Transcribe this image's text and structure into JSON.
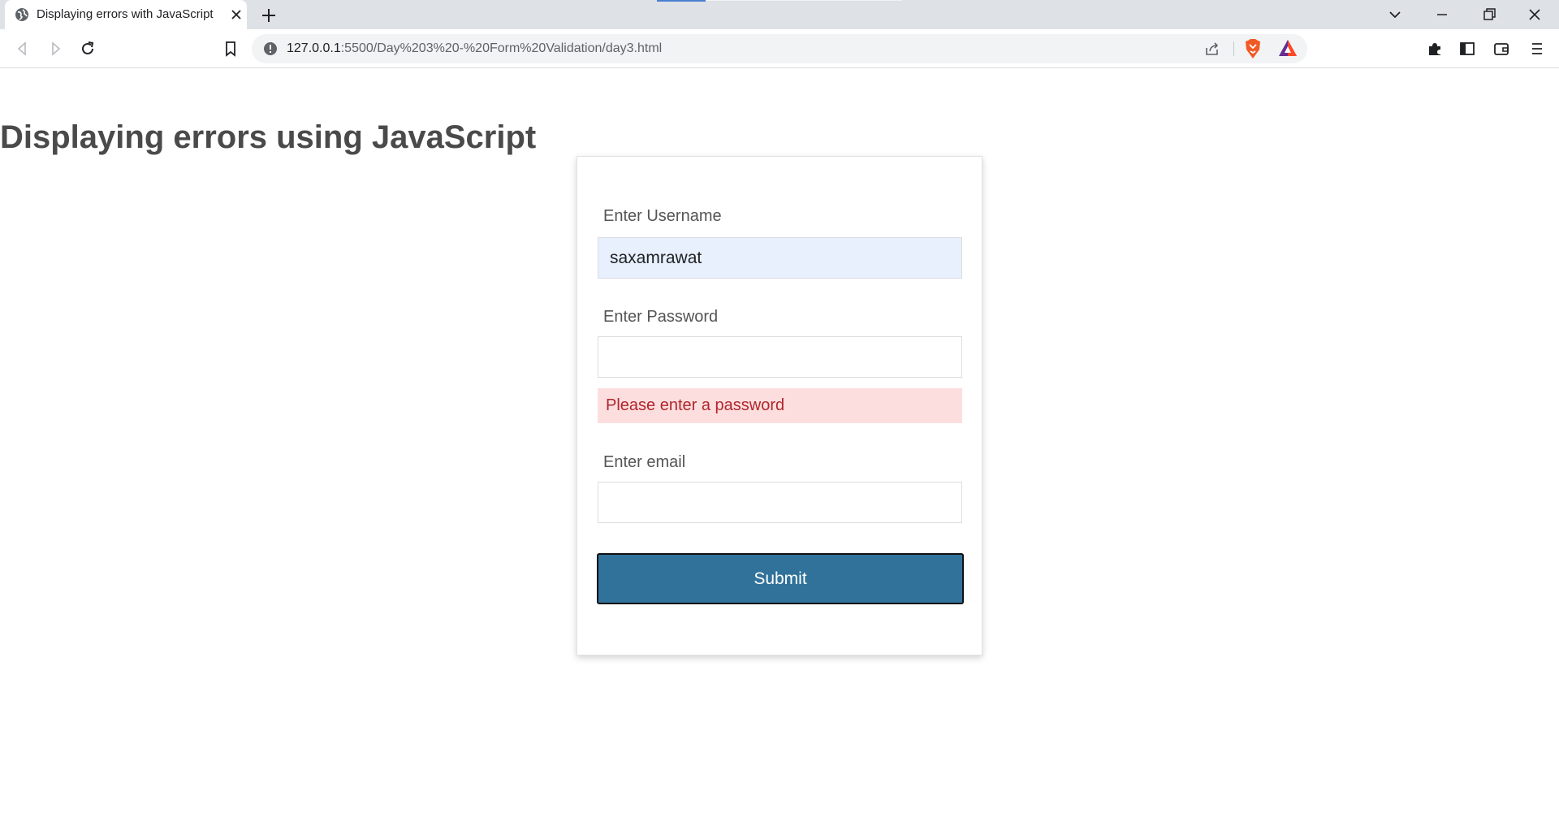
{
  "browser": {
    "tab": {
      "title": "Displaying errors with JavaScript"
    },
    "address": {
      "host": "127.0.0.1",
      "path": ":5500/Day%203%20-%20Form%20Validation/day3.html"
    }
  },
  "page": {
    "heading": "Displaying errors using JavaScript",
    "form": {
      "username": {
        "label": "Enter Username",
        "value": "saxamrawat"
      },
      "password": {
        "label": "Enter Password",
        "value": "",
        "error": "Please enter a password"
      },
      "email": {
        "label": "Enter email",
        "value": ""
      },
      "submit_label": "Submit"
    }
  },
  "colors": {
    "submit_bg": "#31729a",
    "error_bg": "#fddede",
    "error_text": "#b0262d",
    "autofill_bg": "#e8f0fe"
  },
  "icons": {
    "tab_favicon": "globe-icon",
    "tab_close": "close-icon",
    "new_tab": "plus-icon",
    "back": "back-arrow-icon",
    "forward": "forward-arrow-icon",
    "reload": "reload-icon",
    "bookmark": "bookmark-icon",
    "site_info": "info-icon",
    "share": "share-icon",
    "brave": "brave-lion-icon",
    "rewards": "bat-triangle-icon",
    "extensions": "puzzle-icon",
    "sidebar": "sidebar-icon",
    "wallet": "wallet-icon",
    "menu": "hamburger-menu-icon"
  }
}
